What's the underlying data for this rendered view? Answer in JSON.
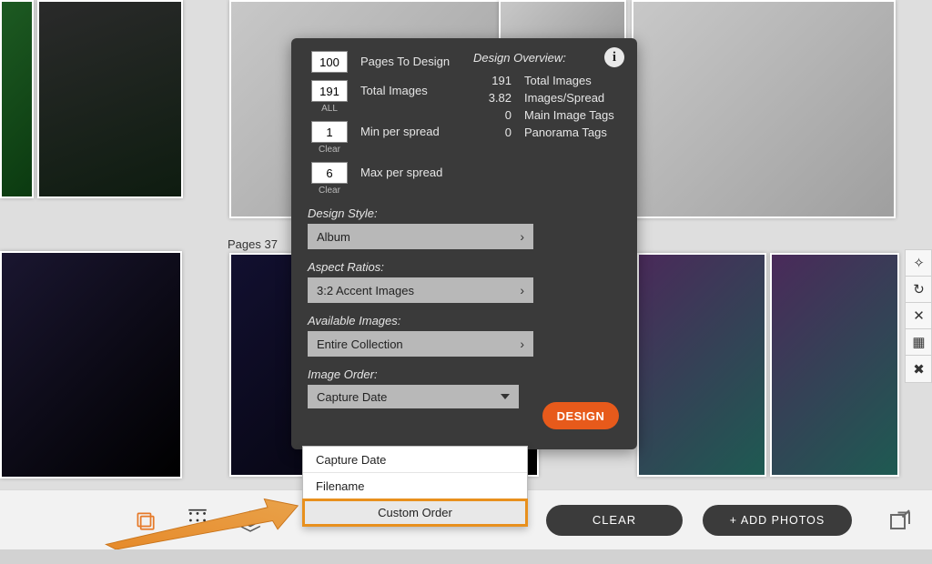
{
  "page_label": "Pages 37",
  "popover": {
    "pages_to_design": {
      "value": "100",
      "label": "Pages To Design"
    },
    "total_images": {
      "value": "191",
      "label": "Total Images",
      "sub": "ALL"
    },
    "min_per_spread": {
      "value": "1",
      "label": "Min per spread",
      "sub": "Clear"
    },
    "max_per_spread": {
      "value": "6",
      "label": "Max per spread",
      "sub": "Clear"
    },
    "overview": {
      "title": "Design Overview:",
      "rows": [
        {
          "n": "191",
          "t": "Total Images"
        },
        {
          "n": "3.82",
          "t": "Images/Spread"
        },
        {
          "n": "0",
          "t": "Main Image Tags"
        },
        {
          "n": "0",
          "t": "Panorama Tags"
        }
      ]
    },
    "design_style": {
      "label": "Design Style:",
      "value": "Album"
    },
    "aspect_ratios": {
      "label": "Aspect Ratios:",
      "value": "3:2 Accent Images"
    },
    "available_images": {
      "label": "Available Images:",
      "value": "Entire Collection"
    },
    "image_order": {
      "label": "Image Order:",
      "value": "Capture Date",
      "options": [
        "Capture Date",
        "Filename",
        "Custom Order"
      ],
      "highlighted": "Custom Order"
    },
    "design_button": "DESIGN"
  },
  "toolbar": {
    "clear": "CLEAR",
    "add_photos": "+ ADD PHOTOS"
  },
  "icons": {
    "info": "i"
  }
}
